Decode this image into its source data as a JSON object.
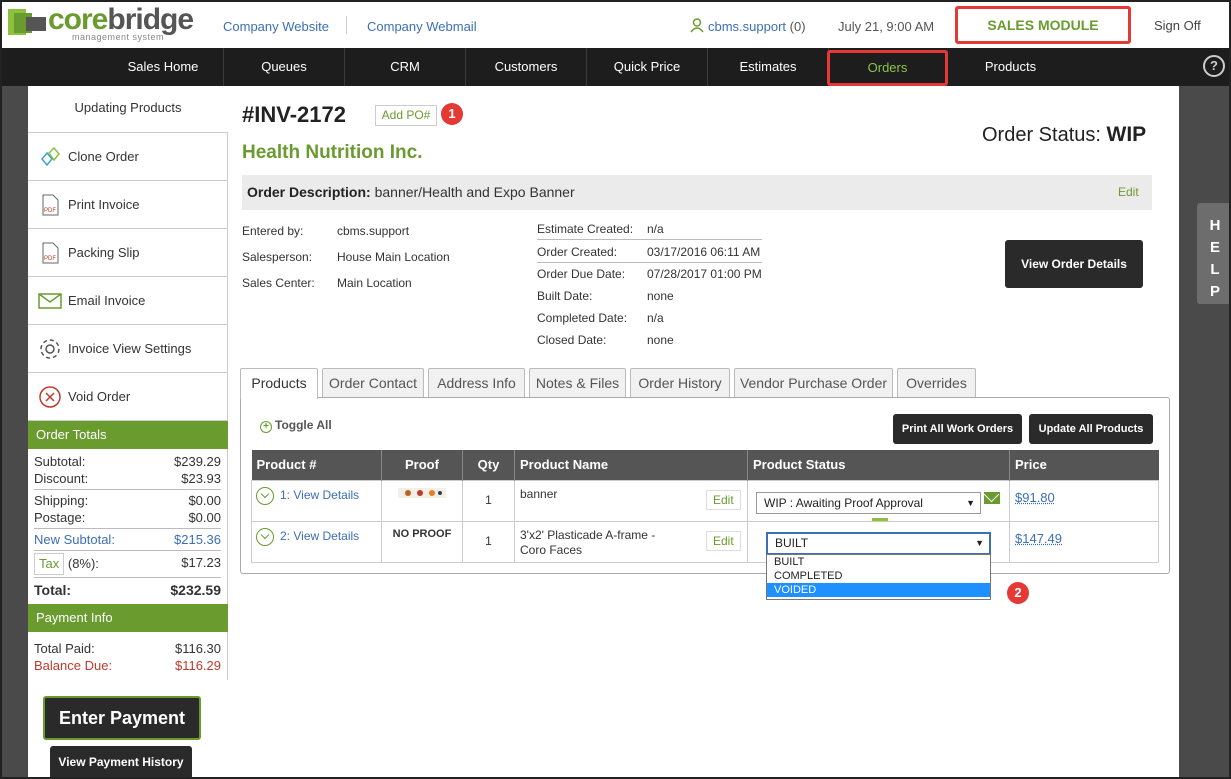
{
  "brand": {
    "name_part1": "core",
    "name_part2": "bridge",
    "tagline": "management system"
  },
  "header": {
    "links": [
      "Company Website",
      "Company Webmail"
    ],
    "user": "cbms.support",
    "user_count": "(0)",
    "datetime": "July 21, 9:00 AM",
    "module": "SALES MODULE",
    "sign_off": "Sign Off"
  },
  "nav": {
    "items": [
      "Sales Home",
      "Queues",
      "CRM",
      "Customers",
      "Quick Price",
      "Estimates",
      "Orders",
      "Products"
    ],
    "active": "Orders",
    "help_icon": "question-circle-icon"
  },
  "sidebar": {
    "title": "Updating Products",
    "actions": [
      {
        "label": "Clone Order",
        "icon": "clone-icon"
      },
      {
        "label": "Print Invoice",
        "icon": "pdf-icon"
      },
      {
        "label": "Packing Slip",
        "icon": "pdf-icon"
      },
      {
        "label": "Email Invoice",
        "icon": "envelope-icon"
      },
      {
        "label": "Invoice View Settings",
        "icon": "gear-icon"
      },
      {
        "label": "Void Order",
        "icon": "x-circle-icon"
      }
    ],
    "totals": {
      "heading": "Order Totals",
      "subtotal_label": "Subtotal:",
      "subtotal": "$239.29",
      "discount_label": "Discount:",
      "discount": "$23.93",
      "shipping_label": "Shipping:",
      "shipping": "$0.00",
      "postage_label": "Postage:",
      "postage": "$0.00",
      "new_subtotal_label": "New Subtotal:",
      "new_subtotal": "$215.36",
      "tax_label": "Tax",
      "tax_rate": "(8%):",
      "tax": "$17.23",
      "total_label": "Total:",
      "total": "$232.59"
    },
    "payment": {
      "heading": "Payment Info",
      "paid_label": "Total Paid:",
      "paid": "$116.30",
      "due_label": "Balance Due:",
      "due": "$116.29"
    },
    "enter_payment": "Enter Payment",
    "payment_history": "View Payment History"
  },
  "order": {
    "number": "#INV-2172",
    "add_po": "Add PO#",
    "company": "Health Nutrition Inc.",
    "status_label": "Order Status:",
    "status": "WIP",
    "description_label": "Order Description:",
    "description": "banner/Health and Expo Banner",
    "edit": "Edit",
    "entered_by_label": "Entered by:",
    "entered_by": "cbms.support",
    "salesperson_label": "Salesperson:",
    "salesperson": "House Main Location",
    "sales_center_label": "Sales Center:",
    "sales_center": "Main Location",
    "dates": [
      {
        "label": "Estimate Created:",
        "value": "n/a"
      },
      {
        "label": "Order Created:",
        "value": "03/17/2016 06:11 AM"
      },
      {
        "label": "Order Due Date:",
        "value": "07/28/2017 01:00 PM"
      },
      {
        "label": "Built Date:",
        "value": "none"
      },
      {
        "label": "Completed Date:",
        "value": "n/a"
      },
      {
        "label": "Closed Date:",
        "value": "none"
      }
    ],
    "view_details": "View Order Details"
  },
  "tabs": [
    "Products",
    "Order Contact",
    "Address Info",
    "Notes & Files",
    "Order History",
    "Vendor Purchase Order",
    "Overrides"
  ],
  "products": {
    "toggle_all": "Toggle All",
    "print_all": "Print All Work Orders",
    "update_all": "Update All Products",
    "columns": [
      "Product #",
      "Proof",
      "Qty",
      "Product Name",
      "Product Status",
      "Price"
    ],
    "rows": [
      {
        "num": "1:",
        "link": "View Details",
        "proof": "",
        "qty": "1",
        "name": "banner",
        "edit": "Edit",
        "status": "WIP : Awaiting Proof Approval",
        "price": "$91.80"
      },
      {
        "num": "2:",
        "link": "View Details",
        "proof": "NO PROOF",
        "qty": "1",
        "name": "3'x2' Plasticade A-frame - Coro Faces",
        "edit": "Edit",
        "status": "BUILT",
        "price": "$147.49"
      }
    ],
    "status_options": [
      "BUILT",
      "COMPLETED",
      "VOIDED"
    ],
    "highlighted_option": "VOIDED"
  },
  "callouts": [
    "1",
    "2"
  ],
  "help_tab": [
    "H",
    "E",
    "L",
    "P"
  ],
  "colors": {
    "brand_green": "#6a9b2f",
    "nav_bg": "#1d1d1d",
    "callout_red": "#e53935",
    "link_blue": "#3b6fb6"
  }
}
